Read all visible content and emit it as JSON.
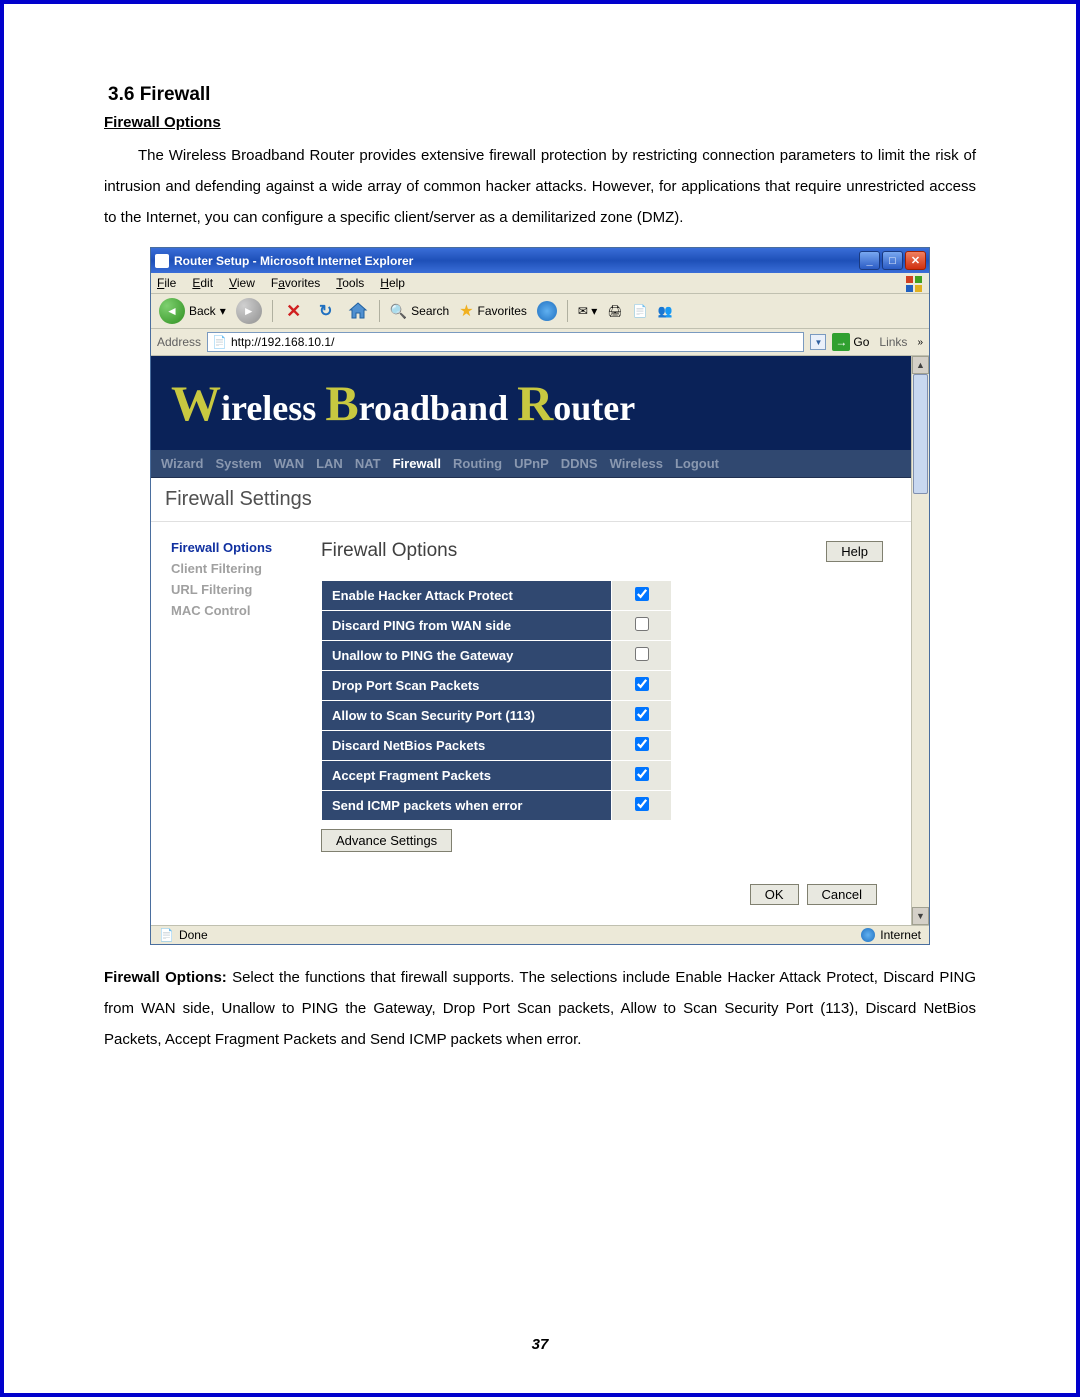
{
  "doc": {
    "heading": "3.6   Firewall",
    "subheading": "Firewall Options",
    "intro": "The Wireless Broadband Router provides extensive firewall protection by restricting connection parameters to limit the risk of intrusion and defending against a wide array of common hacker attacks. However, for applications that require unrestricted access to the Internet, you can configure a specific client/server as a demilitarized zone (DMZ).",
    "caption_bold": "Firewall Options:",
    "caption_rest": " Select the functions that firewall supports. The selections include Enable Hacker Attack Protect, Discard PING from WAN side, Unallow to PING the Gateway, Drop Port Scan packets, Allow to Scan Security Port (113), Discard NetBios Packets, Accept Fragment Packets and Send ICMP packets when error.",
    "page_number": "37"
  },
  "ie": {
    "title": "Router Setup - Microsoft Internet Explorer",
    "menu": {
      "file": "File",
      "edit": "Edit",
      "view": "View",
      "favorites": "Favorites",
      "tools": "Tools",
      "help": "Help"
    },
    "toolbar": {
      "back": "Back",
      "search": "Search",
      "favorites": "Favorites"
    },
    "address": {
      "label": "Address",
      "url": "http://192.168.10.1/",
      "go": "Go",
      "links": "Links"
    },
    "status": {
      "done": "Done",
      "zone": "Internet"
    }
  },
  "router": {
    "banner_parts": {
      "w": "W",
      "wireless": "ireless ",
      "b": "B",
      "broadband": "roadband ",
      "r": "R",
      "router": "outer"
    },
    "nav": [
      "Wizard",
      "System",
      "WAN",
      "LAN",
      "NAT",
      "Firewall",
      "Routing",
      "UPnP",
      "DDNS",
      "Wireless",
      "Logout"
    ],
    "nav_active_index": 5,
    "section_title": "Firewall Settings",
    "side_menu": [
      {
        "label": "Firewall Options",
        "selected": true
      },
      {
        "label": "Client Filtering",
        "selected": false
      },
      {
        "label": "URL Filtering",
        "selected": false
      },
      {
        "label": "MAC Control",
        "selected": false
      }
    ],
    "panel_title": "Firewall Options",
    "help_label": "Help",
    "options": [
      {
        "label": "Enable Hacker Attack Protect",
        "checked": true
      },
      {
        "label": "Discard PING from WAN side",
        "checked": false
      },
      {
        "label": "Unallow to PING the Gateway",
        "checked": false
      },
      {
        "label": "Drop Port Scan Packets",
        "checked": true
      },
      {
        "label": "Allow to Scan Security Port (113)",
        "checked": true
      },
      {
        "label": "Discard NetBios Packets",
        "checked": true
      },
      {
        "label": "Accept Fragment Packets",
        "checked": true
      },
      {
        "label": "Send ICMP packets when error",
        "checked": true
      }
    ],
    "advance_label": "Advance Settings",
    "ok_label": "OK",
    "cancel_label": "Cancel"
  }
}
